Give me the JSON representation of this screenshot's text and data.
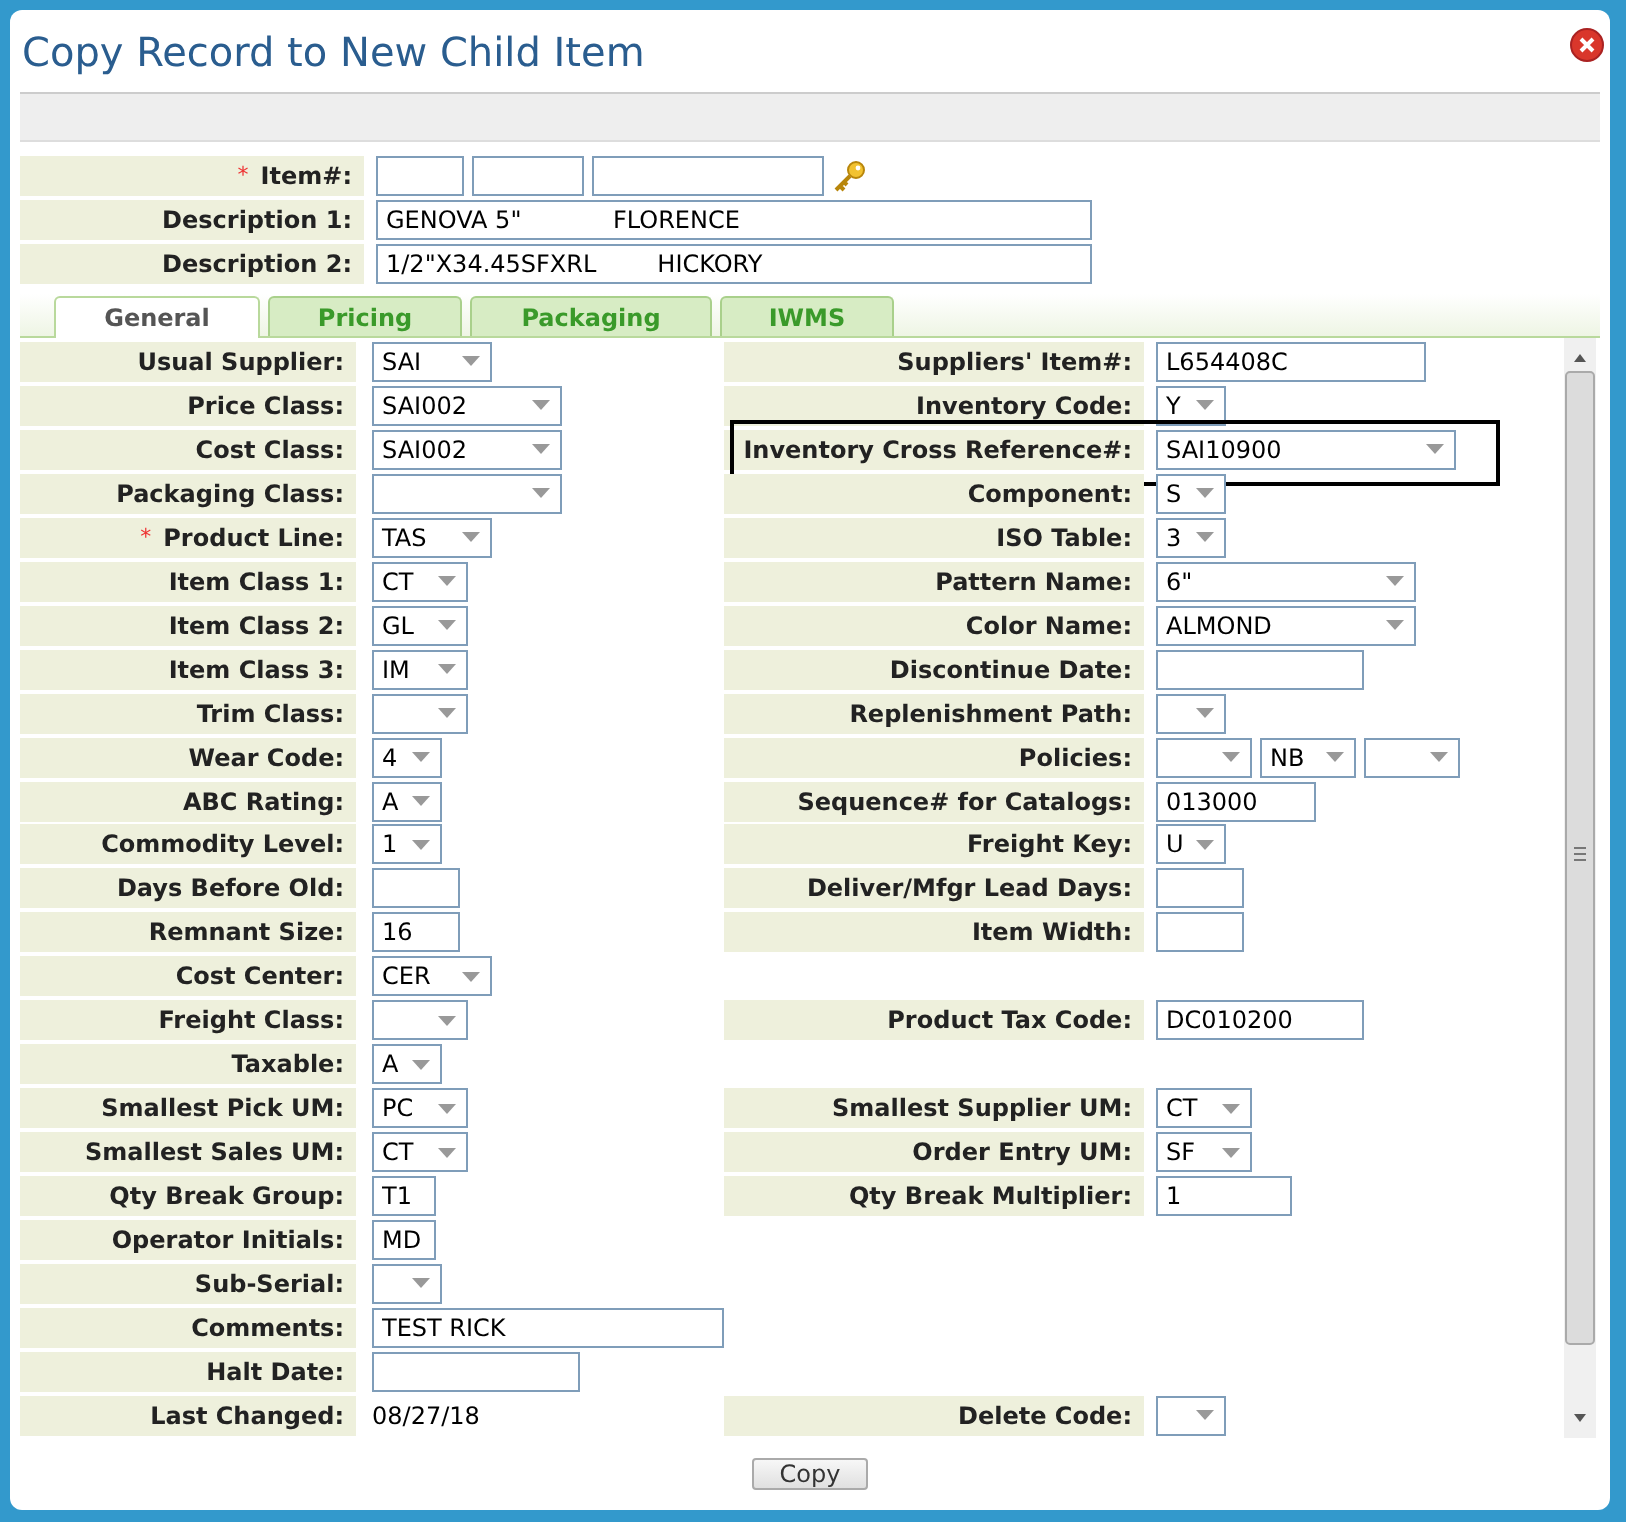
{
  "window": {
    "title": "Copy Record to New Child Item"
  },
  "header": [
    {
      "label": "Item#:",
      "marker": "*",
      "kind": "item",
      "fields": [
        {
          "kind": "input"
        },
        {
          "kind": "input"
        },
        {
          "kind": "input"
        }
      ]
    },
    {
      "label": "Description 1:",
      "kind": "text",
      "value": "GENOVA 5\"            FLORENCE"
    },
    {
      "label": "Description 2:",
      "kind": "text",
      "value": "1/2\"X34.45SFXRL        HICKORY"
    }
  ],
  "tabs": [
    {
      "label": "General",
      "selected": true
    },
    {
      "label": "Pricing",
      "selected": false
    },
    {
      "label": "Packaging",
      "selected": false
    },
    {
      "label": "IWMS",
      "selected": false
    }
  ],
  "rows": [
    {
      "left": {
        "label": "Usual Supplier:",
        "kind": "select",
        "value": "SAI"
      },
      "right": {
        "label": "Suppliers' Item#:",
        "kind": "input",
        "value": "L654408C",
        "outlined": false
      }
    },
    {
      "left": {
        "label": "Price Class:",
        "kind": "select",
        "value": "SAI002"
      },
      "right": {
        "label": "Inventory Code:",
        "kind": "select",
        "value": "Y",
        "outlined": false
      }
    },
    {
      "left": {
        "label": "Cost Class:",
        "kind": "select",
        "value": "SAI002"
      },
      "right": {
        "label": "Inventory Cross Reference#:",
        "kind": "select",
        "value": "SAI10900",
        "outlined": true
      }
    },
    {
      "left": {
        "label": "Packaging Class:",
        "kind": "select"
      },
      "right": {
        "label": "Component:",
        "kind": "select",
        "value": "S",
        "outlined": false
      }
    },
    {
      "left": {
        "label": "Product Line:",
        "marker": "*",
        "kind": "select",
        "value": "TAS"
      },
      "right": {
        "label": "ISO Table:",
        "kind": "select",
        "value": "3",
        "outlined": false
      }
    },
    {
      "left": {
        "label": "Item Class 1:",
        "kind": "select",
        "value": "CT"
      },
      "right": {
        "label": "Pattern Name:",
        "kind": "select",
        "value": "6\"",
        "outlined": false
      }
    },
    {
      "left": {
        "label": "Item Class 2:",
        "kind": "select",
        "value": "GL"
      },
      "right": {
        "label": "Color Name:",
        "kind": "select",
        "value": "ALMOND",
        "outlined": false
      }
    },
    {
      "left": {
        "label": "Item Class 3:",
        "kind": "select",
        "value": "IM"
      },
      "right": {
        "label": "Discontinue Date:",
        "kind": "input",
        "outlined": false
      }
    },
    {
      "left": {
        "label": "Trim Class:",
        "kind": "select"
      },
      "right": {
        "label": "Replenishment Path:",
        "kind": "select",
        "outlined": false
      }
    },
    {
      "left": {
        "label": "Wear Code:",
        "kind": "select",
        "value": "4"
      },
      "right": {
        "label": "Policies:",
        "kind": "selects",
        "items": [
          {
            "kind": "select"
          },
          {
            "kind": "select",
            "value": "NB"
          },
          {
            "kind": "select"
          }
        ],
        "outlined": false
      }
    },
    {
      "left": {
        "label": "ABC Rating:",
        "kind": "select",
        "value": "A"
      },
      "right": {
        "label": "Sequence# for Catalogs:",
        "kind": "input",
        "value": "013000",
        "outlined": false
      }
    },
    {
      "left": {
        "label": "Commodity Level:",
        "kind": "select",
        "value": "1"
      },
      "right": {
        "label": "Freight Key:",
        "kind": "select",
        "value": "U",
        "outlined": false
      }
    },
    {
      "left": {
        "label": "Days Before Old:",
        "kind": "input"
      },
      "right": {
        "label": "Deliver/Mfgr Lead Days:",
        "kind": "input",
        "outlined": false
      }
    },
    {
      "left": {
        "label": "Remnant Size:",
        "kind": "input",
        "value": "16"
      },
      "right": {
        "label": "Item Width:",
        "kind": "input",
        "outlined": false
      }
    },
    {
      "left": {
        "label": "Cost Center:",
        "kind": "select",
        "value": "CER"
      }
    },
    {
      "left": {
        "label": "Freight Class:",
        "kind": "select"
      },
      "right": {
        "label": "Product Tax Code:",
        "kind": "input",
        "value": "DC010200",
        "outlined": false
      }
    },
    {
      "left": {
        "label": "Taxable:",
        "kind": "select",
        "value": "A"
      }
    },
    {
      "left": {
        "label": "Smallest Pick UM:",
        "kind": "select",
        "value": "PC"
      },
      "right": {
        "label": "Smallest Supplier UM:",
        "kind": "select",
        "value": "CT",
        "outlined": false
      }
    },
    {
      "left": {
        "label": "Smallest Sales UM:",
        "kind": "select",
        "value": "CT"
      },
      "right": {
        "label": "Order Entry UM:",
        "kind": "select",
        "value": "SF",
        "outlined": false
      }
    },
    {
      "left": {
        "label": "Qty Break Group:",
        "kind": "input",
        "value": "T1"
      },
      "right": {
        "label": "Qty Break Multiplier:",
        "kind": "input",
        "value": "1",
        "outlined": false
      }
    },
    {
      "left": {
        "label": "Operator Initials:",
        "kind": "input",
        "value": "MD"
      }
    },
    {
      "left": {
        "label": "Sub-Serial:",
        "kind": "select"
      }
    },
    {
      "left": {
        "label": "Comments:",
        "kind": "input",
        "value": "TEST RICK"
      }
    },
    {
      "left": {
        "label": "Halt Date:",
        "kind": "input"
      }
    },
    {
      "left": {
        "label": "Last Changed:",
        "kind": "text",
        "value": "08/27/18"
      },
      "right": {
        "label": "Delete Code:",
        "kind": "select",
        "outlined": false
      }
    }
  ],
  "buttons": [
    "Copy"
  ]
}
